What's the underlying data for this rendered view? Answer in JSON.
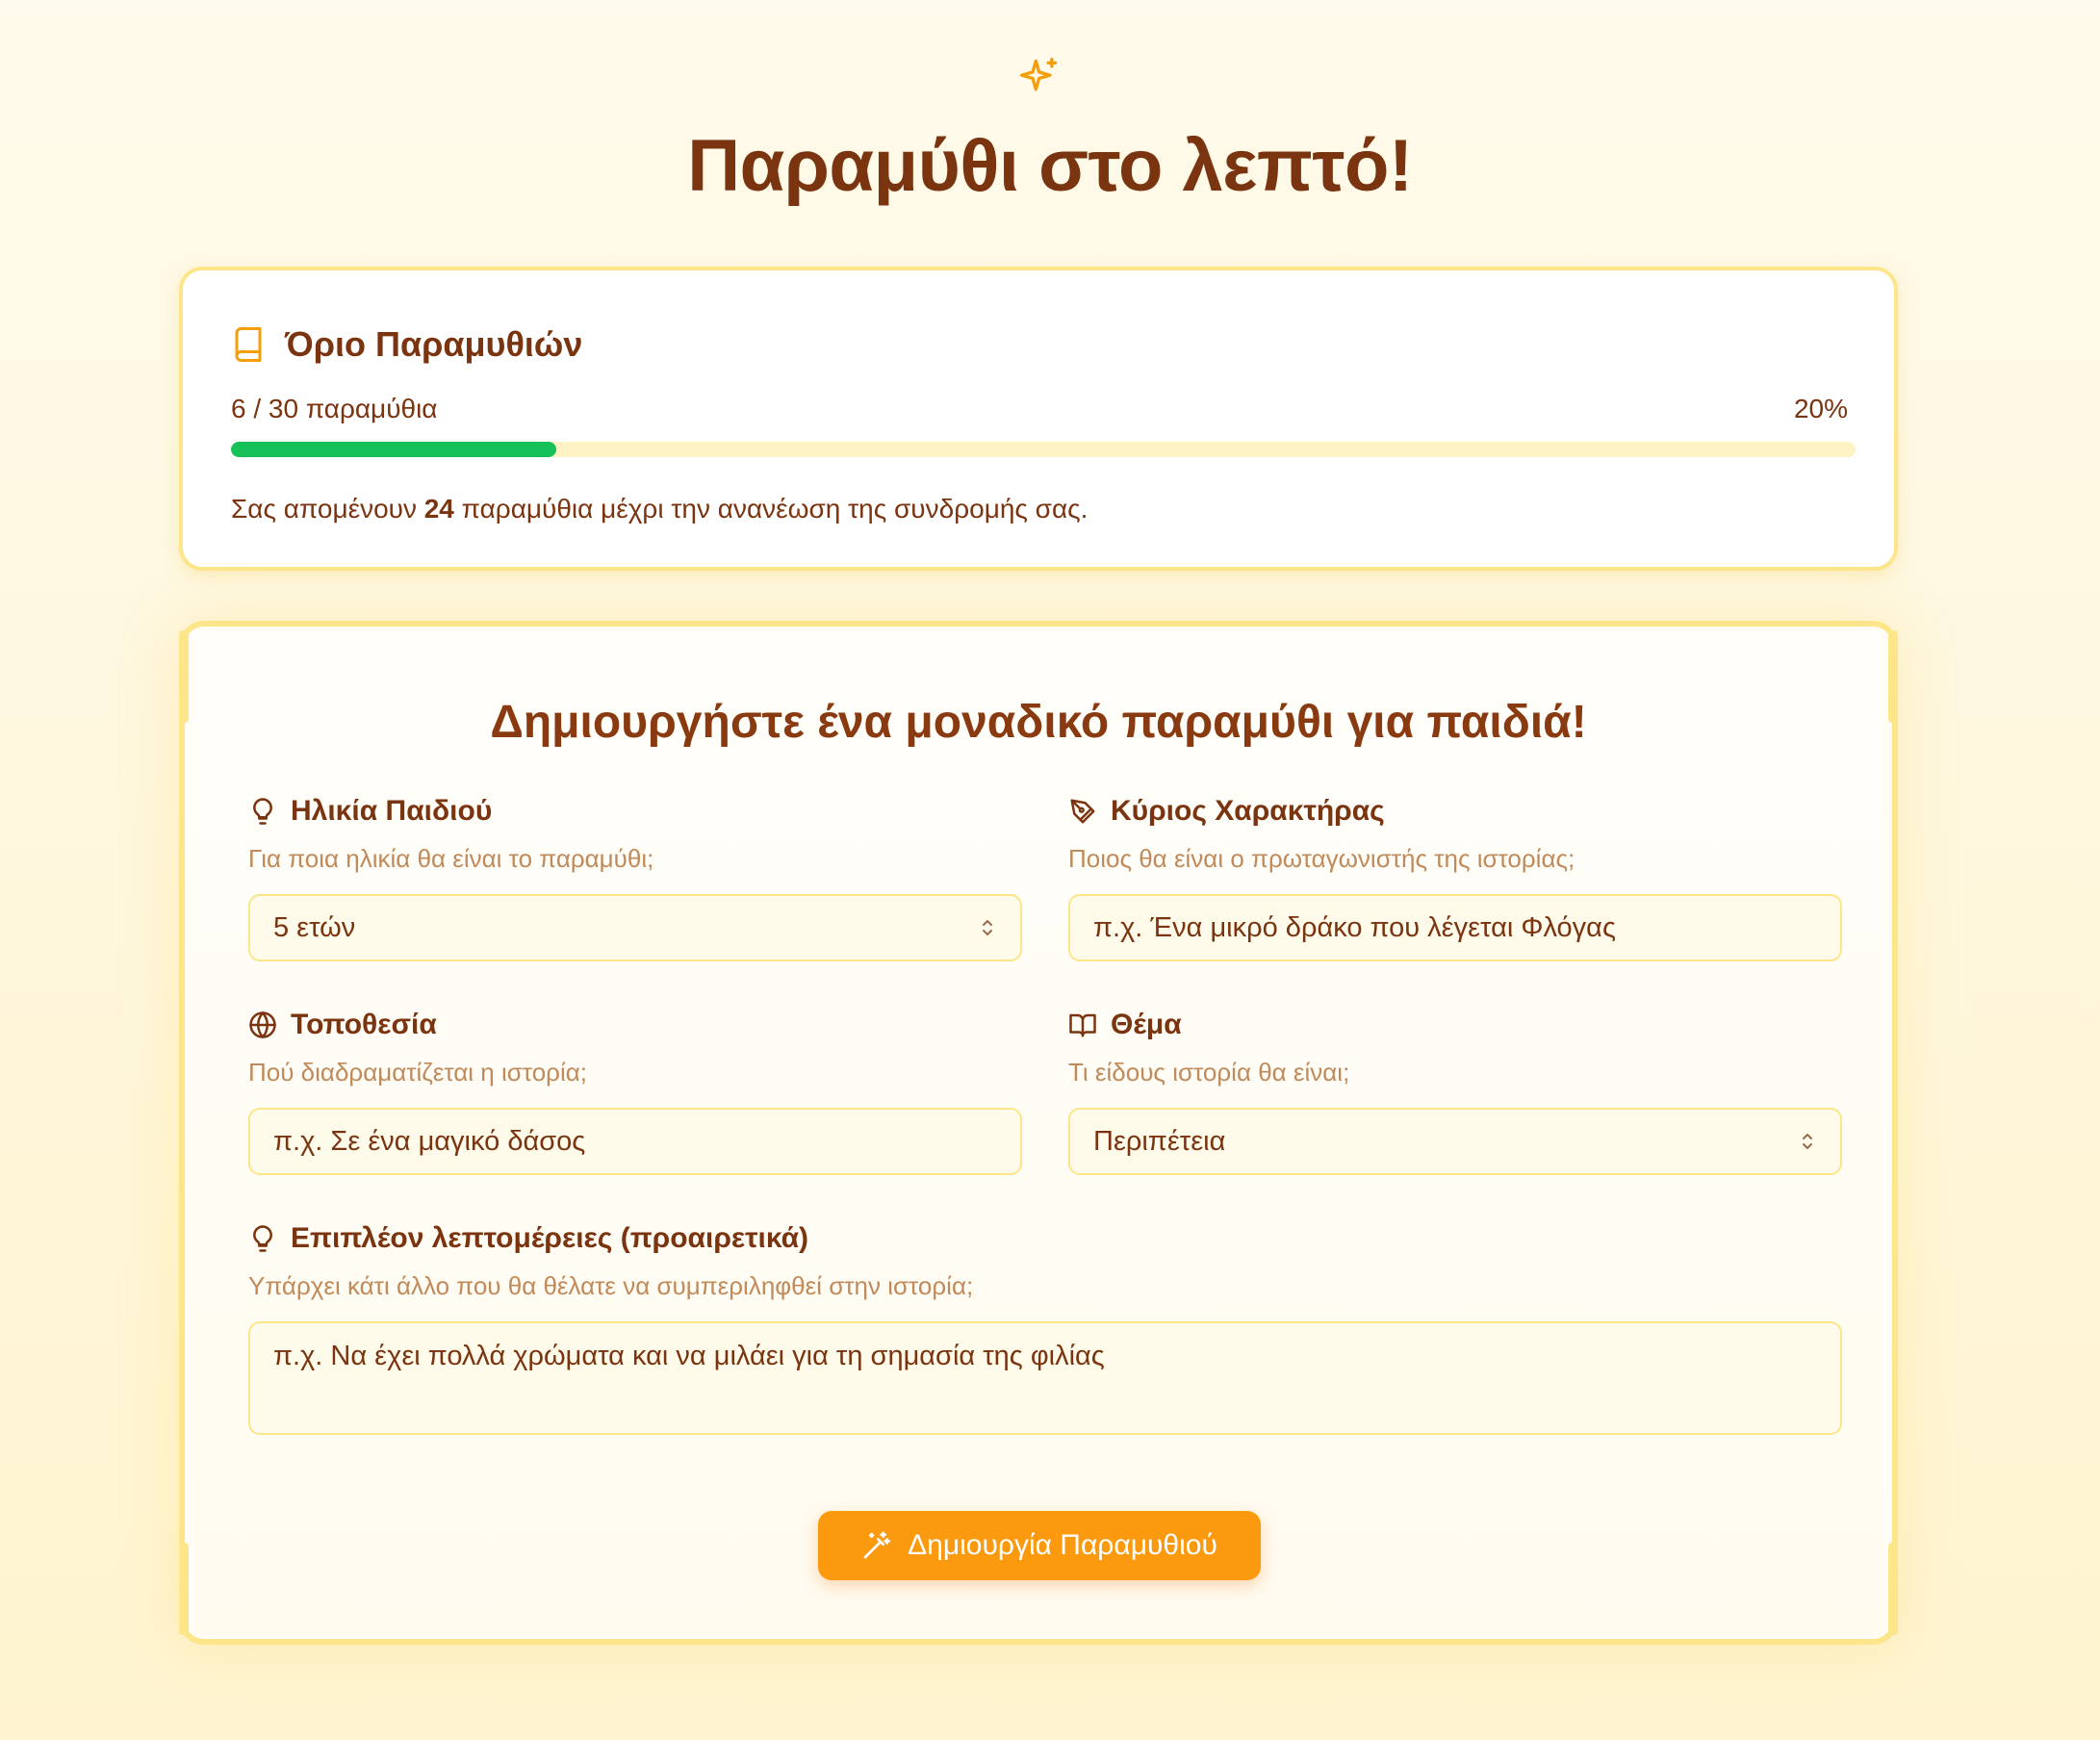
{
  "header": {
    "title": "Παραμύθι στο λεπτό!",
    "icon": "sparkles-icon"
  },
  "usage_card": {
    "title": "Όριο Παραμυθιών",
    "icon": "book-icon",
    "usage_text": "6 / 30 παραμύθια",
    "percent_text": "20%",
    "progress_fraction": 0.2,
    "remaining_prefix": "Σας απομένουν",
    "remaining_count": "24",
    "remaining_suffix": "παραμύθια μέχρι την ανανέωση της συνδρομής σας.",
    "progress_color": "#16c15a"
  },
  "form": {
    "title": "Δημιουργήστε ένα μοναδικό παραμύθι για παιδιά!",
    "age": {
      "label": "Ηλικία Παιδιού",
      "help": "Για ποια ηλικία θα είναι το παραμύθι;",
      "value": "5 ετών",
      "icon": "lightbulb-icon"
    },
    "character": {
      "label": "Κύριος Χαρακτήρας",
      "help": "Ποιος θα είναι ο πρωταγωνιστής της ιστορίας;",
      "placeholder": "π.χ. Ένα μικρό δράκο που λέγεται Φλόγας",
      "icon": "pen-tool-icon"
    },
    "location": {
      "label": "Τοποθεσία",
      "help": "Πού διαδραματίζεται η ιστορία;",
      "placeholder": "π.χ. Σε ένα μαγικό δάσος",
      "icon": "globe-icon"
    },
    "theme": {
      "label": "Θέμα",
      "help": "Τι είδους ιστορία θα είναι;",
      "value": "Περιπέτεια",
      "icon": "open-book-icon"
    },
    "details": {
      "label": "Επιπλέον λεπτομέρειες (προαιρετικά)",
      "help": "Υπάρχει κάτι άλλο που θα θέλατε να συμπεριληφθεί στην ιστορία;",
      "placeholder": "π.χ. Να έχει πολλά χρώματα και να μιλάει για τη σημασία της φιλίας",
      "icon": "lightbulb-icon"
    },
    "submit_label": "Δημιουργία Παραμυθιού",
    "submit_icon": "magic-wand-icon",
    "accent_color": "#fb9a0e"
  }
}
